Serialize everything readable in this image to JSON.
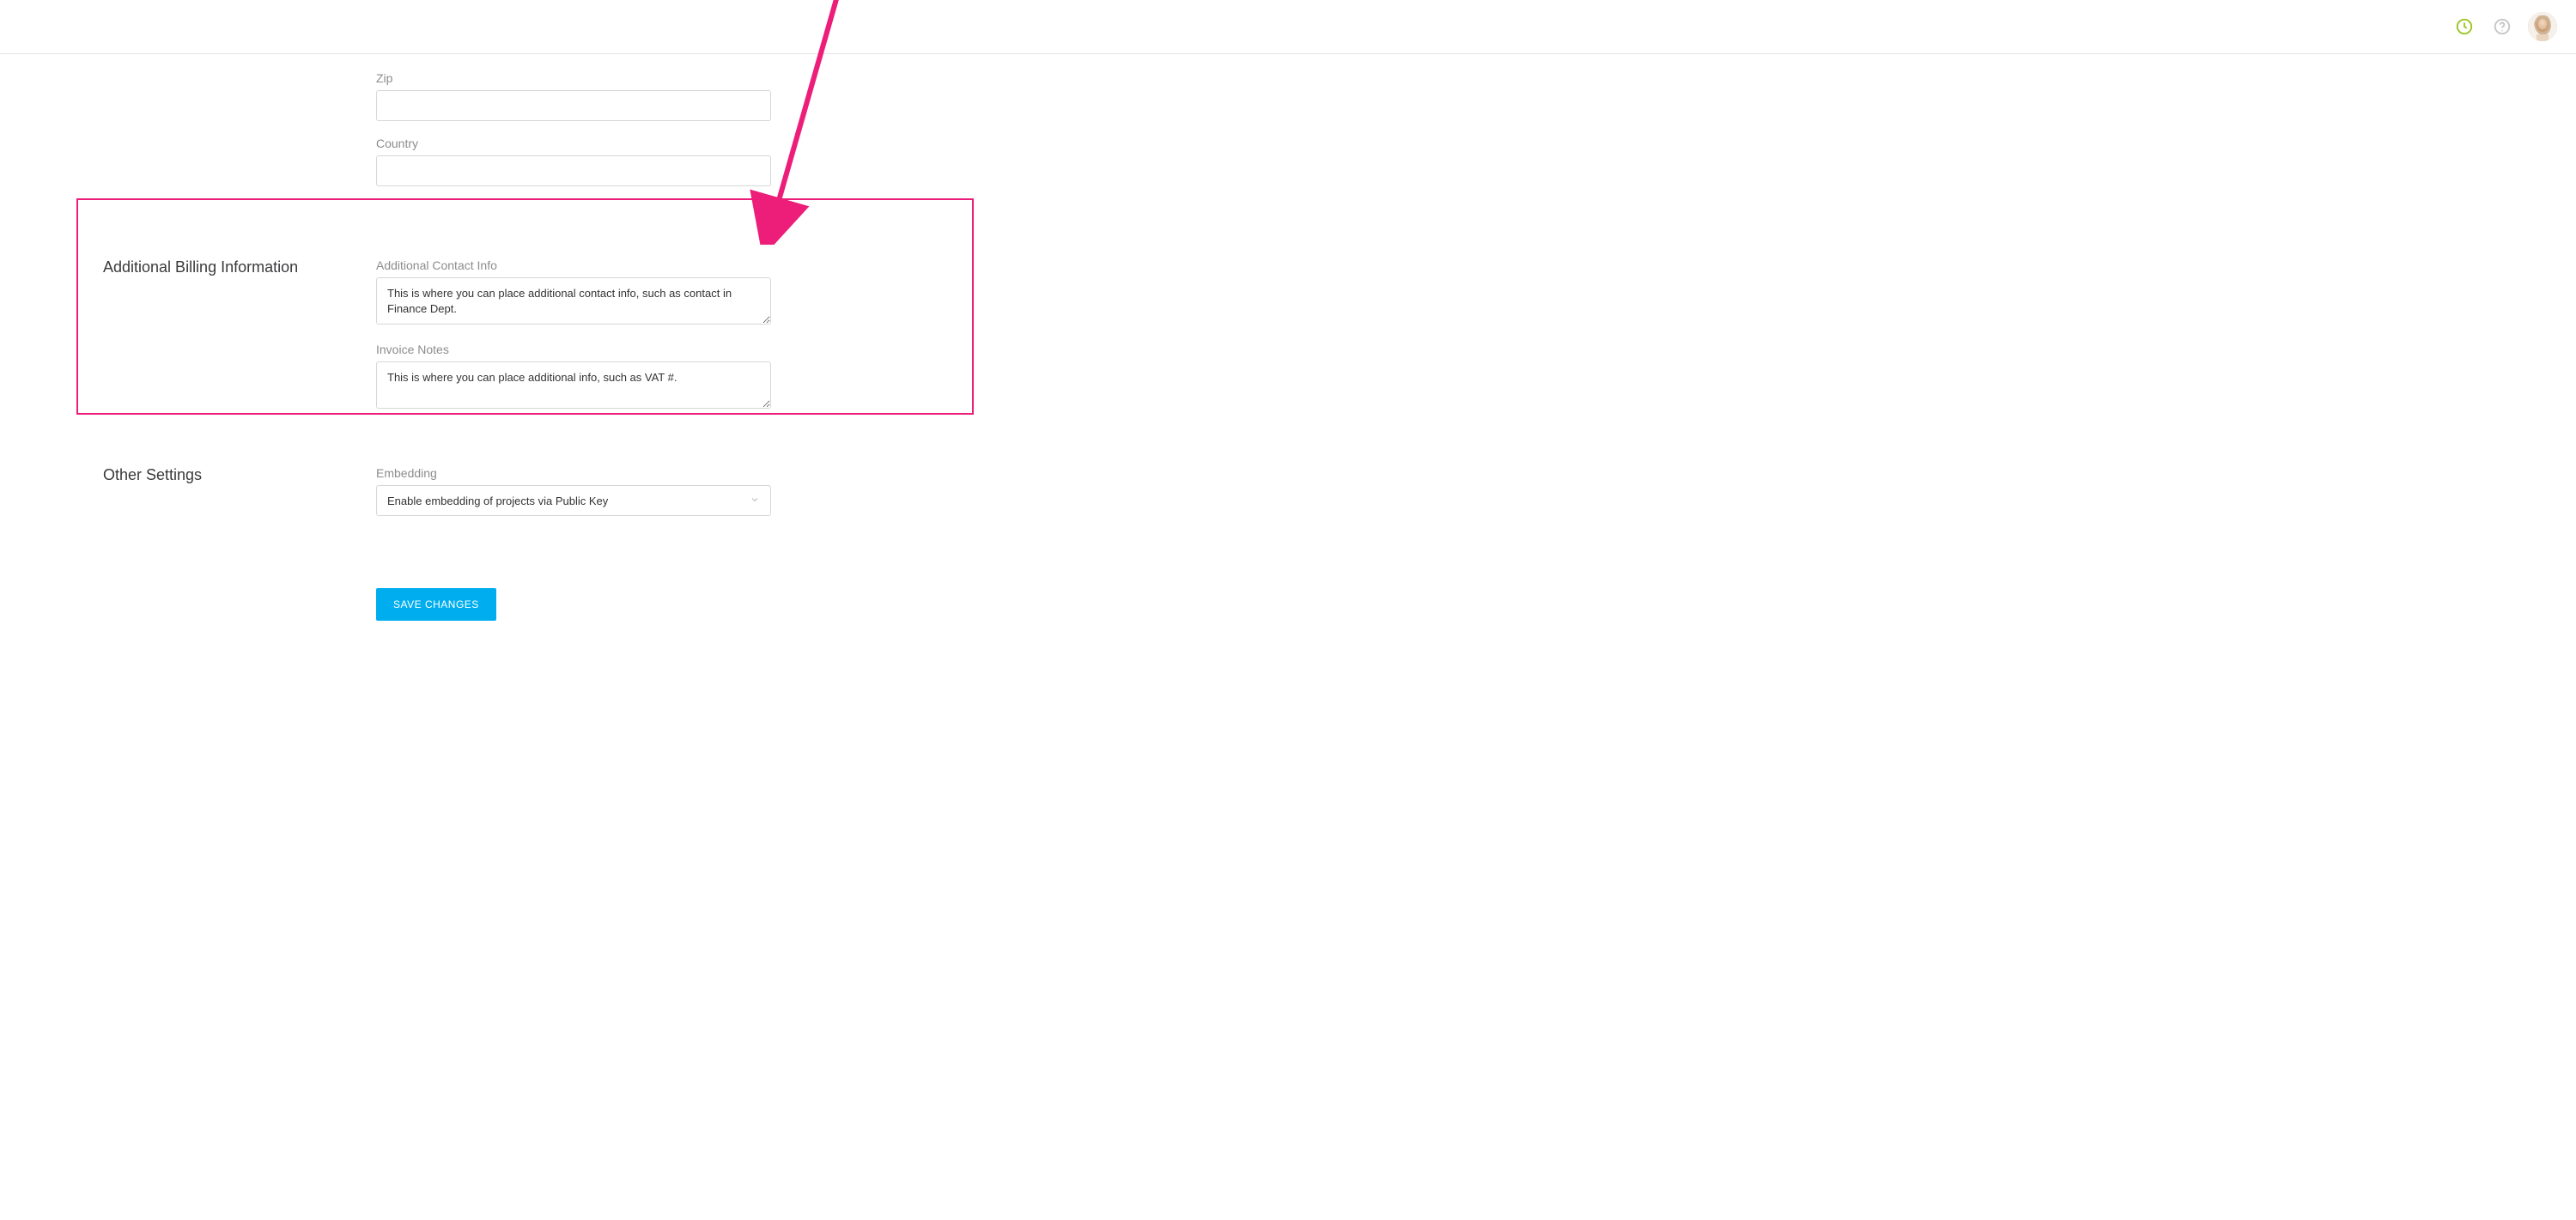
{
  "header": {
    "clock_icon": "clock-icon",
    "help_icon": "help-icon",
    "avatar": "user-avatar"
  },
  "address": {
    "zip_label": "Zip",
    "zip_value": "",
    "country_label": "Country",
    "country_value": ""
  },
  "billing": {
    "section_title": "Additional Billing Information",
    "contact_label": "Additional Contact Info",
    "contact_value": "This is where you can place additional contact info, such as contact in Finance Dept.",
    "notes_label": "Invoice Notes",
    "notes_value": "This is where you can place additional info, such as VAT #."
  },
  "other": {
    "section_title": "Other Settings",
    "embedding_label": "Embedding",
    "embedding_selected": "Enable embedding of projects via Public Key"
  },
  "actions": {
    "save_label": "SAVE CHANGES"
  },
  "colors": {
    "accent": "#00aeef",
    "highlight": "#ed1e79",
    "icon_green": "#9ac31c"
  }
}
